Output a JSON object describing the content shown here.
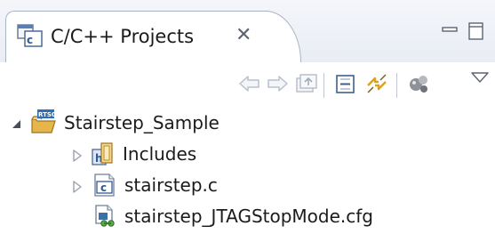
{
  "view": {
    "title": "C/C++ Projects",
    "close_glyph": "✕",
    "icons": {
      "tab": "projects-view-icon",
      "minimize": "minimize-icon",
      "maximize": "maximize-icon"
    }
  },
  "toolbar": {
    "buttons": [
      {
        "name": "back-icon",
        "enabled": false
      },
      {
        "name": "forward-icon",
        "enabled": false
      },
      {
        "name": "go-home-icon",
        "enabled": false
      },
      {
        "name": "collapse-all-icon",
        "enabled": true
      },
      {
        "name": "link-with-editor-icon",
        "enabled": true
      },
      {
        "name": "filters-icon",
        "enabled": true
      },
      {
        "name": "view-menu-icon",
        "enabled": true
      }
    ]
  },
  "tree": {
    "project": {
      "label": "Stairstep_Sample",
      "expanded": true,
      "icon": "rtsc-project-icon",
      "badge": "RTSC"
    },
    "children": [
      {
        "label": "Includes",
        "expandable": true,
        "icon": "includes-folder-icon"
      },
      {
        "label": "stairstep.c",
        "expandable": true,
        "icon": "c-source-file-icon"
      },
      {
        "label": "stairstep_JTAGStopMode.cfg",
        "expandable": false,
        "icon": "cfg-file-icon"
      }
    ]
  },
  "colors": {
    "text": "#1b1b1b",
    "tab_border": "#a9b4c4",
    "header_bg": "#e9edf4",
    "disabled_icon": "#b8c0cc",
    "twisty": "#9aa1ab"
  }
}
